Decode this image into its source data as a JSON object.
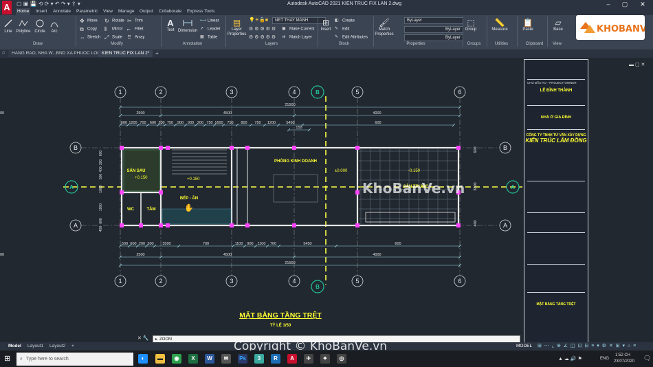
{
  "app": {
    "logo": "A",
    "title": "Autodesk AutoCAD 2021    KIEN TRUC FIX LAN 2.dwg"
  },
  "ribbon_tabs": [
    "Home",
    "Insert",
    "Annotate",
    "Parametric",
    "View",
    "Manage",
    "Output",
    "Collaborate",
    "Express Tools"
  ],
  "ribbon": {
    "draw": {
      "label": "Draw",
      "line": "Line",
      "polyline": "Polyline",
      "circle": "Circle",
      "arc": "Arc"
    },
    "modify": {
      "label": "Modify",
      "move": "Move",
      "rotate": "Rotate",
      "trim": "Trim",
      "copy": "Copy",
      "mirror": "Mirror",
      "fillet": "Fillet",
      "stretch": "Stretch",
      "scale": "Scale",
      "array": "Array"
    },
    "annotation": {
      "label": "Annotation",
      "text": "Text",
      "dimension": "Dimension",
      "linear": "Linear",
      "leader": "Leader",
      "table": "Table"
    },
    "layers": {
      "label": "Layers",
      "layer_properties": "Layer Properties",
      "current_layer": "NET THAY MANH",
      "make_current": "Make Current",
      "match_layer": "Match Layer"
    },
    "block": {
      "label": "Block",
      "insert": "Insert",
      "create": "Create",
      "edit": "Edit",
      "edit_attributes": "Edit Attributes"
    },
    "properties": {
      "label": "Properties",
      "match_properties": "Match Properties",
      "color": "ByLayer",
      "linetype": "ByLayer",
      "lineweight": "ByLayer"
    },
    "groups": {
      "label": "Groups",
      "group": "Group"
    },
    "utilities": {
      "label": "Utilities",
      "measure": "Measure"
    },
    "clipboard": {
      "label": "Clipboard",
      "paste": "Paste"
    },
    "view": {
      "label": "View",
      "base": "Base"
    }
  },
  "doc_tabs": [
    {
      "label": "HANG RAO, NHA W...BND XA PHUOC LOC"
    },
    {
      "label": "KIEN TRUC FIX LAN 2*"
    }
  ],
  "drawing": {
    "grid_top": [
      "1",
      "2",
      "3",
      "4",
      "5",
      "6"
    ],
    "grid_side": [
      "B",
      "A"
    ],
    "section_mark": "B",
    "section_side": "A",
    "total_dim": "21500",
    "segments_top": [
      "2500",
      "4500",
      "4000",
      "6500"
    ],
    "sub_top": [
      "600",
      "1200",
      "700",
      "600",
      "200",
      "750",
      "900",
      "900",
      "200",
      "750",
      "1600",
      "750",
      "800",
      "750",
      "1200",
      "5450",
      "600"
    ],
    "sub_bottom": [
      "500",
      "600",
      "200",
      "300",
      "3500",
      "700",
      "1100",
      "900",
      "1100",
      "700",
      "5450",
      "600"
    ],
    "dim_150": "150",
    "side_left": [
      "600",
      "300",
      "400",
      "500",
      "1800",
      "1900",
      "600",
      "400"
    ],
    "side_right": [
      "600",
      "3800",
      "400"
    ],
    "rooms": {
      "kho": "SÂN SAU",
      "kitchen": "BẾP - ĂN",
      "wc": "WC",
      "tam": "TẮM",
      "business": "PHÒNG KINH DOANH",
      "yard": "SÂN TRƯỚC"
    },
    "levels": [
      "+0.150",
      "+0.150",
      "±0.000",
      "-0.150"
    ],
    "plan_title": "MẶT BẰNG TẦNG TRỆT",
    "scale": "TỶ LỆ 1/50"
  },
  "titleblock": {
    "owner_label": "CHỦ ĐẦU TƯ - PROJECT OWNER",
    "owner": "LÊ ĐÌNH THÀNH",
    "project": "NHÀ Ở GIA ĐÌNH",
    "company": "CÔNG TY TNHH TƯ VẤN XÂY DỰNG",
    "company_name": "KIẾN TRÚC LÂM ĐỒNG",
    "sheet_title": "MẶT BẰNG TẦNG TRỆT"
  },
  "command": {
    "prompt": "ZOOM"
  },
  "layout_tabs": [
    "Model",
    "Layout1",
    "Layout2",
    "+"
  ],
  "status": {
    "model": "MODEL"
  },
  "taskbar": {
    "search_placeholder": "Type here to search",
    "lang": "ENG",
    "time": "1:52 CH",
    "date": "23/07/2020"
  },
  "watermark": {
    "logo": "KHOBANVE",
    "center": "KhoBanVe.vn",
    "copyright": "Copyright © KhoBanVe.vn"
  },
  "colors": {
    "background": "#212830",
    "ribbon": "#3b4453",
    "grid_axis": "#ffff44",
    "wall": "#ff44ff",
    "dim": "#9fd8e6",
    "text_yellow": "#ffff33",
    "section": "#22c39a",
    "autocad_red": "#c8102e"
  }
}
